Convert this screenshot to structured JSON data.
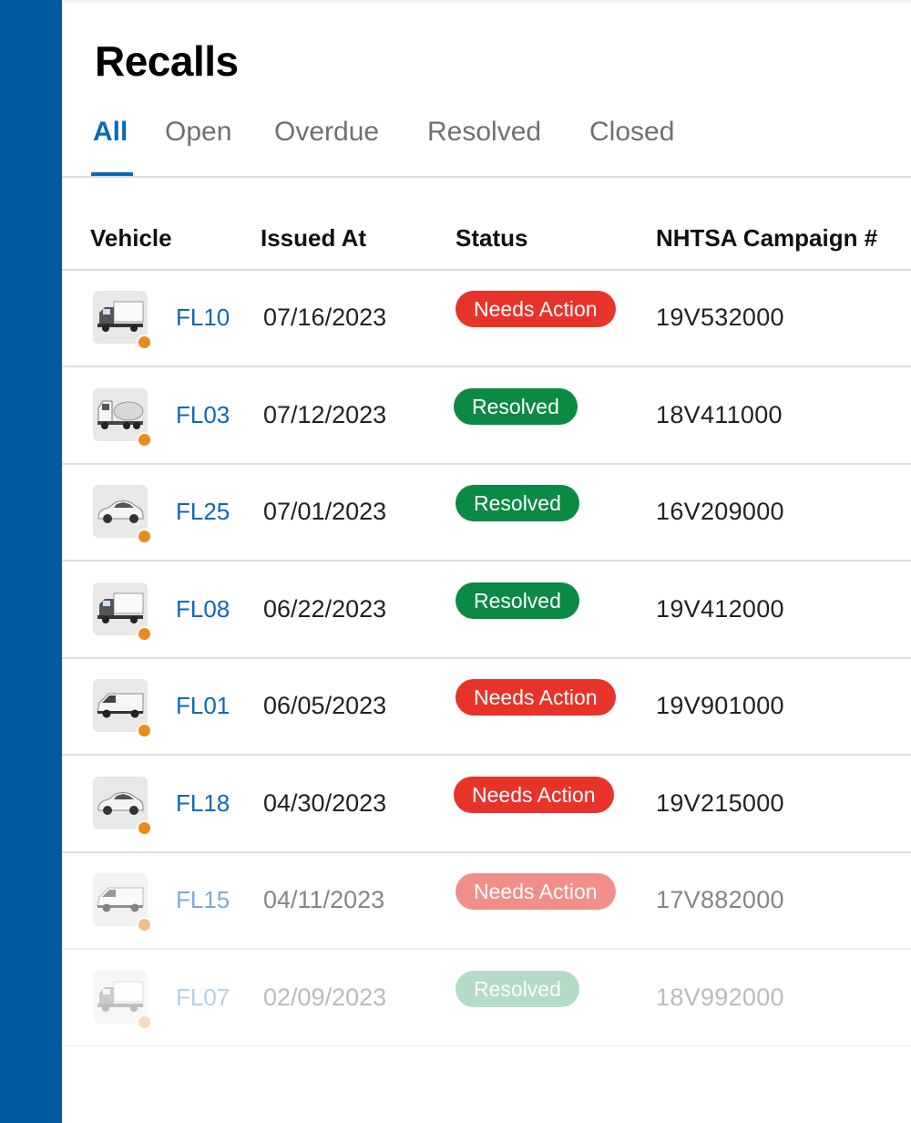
{
  "page": {
    "title": "Recalls"
  },
  "tabs": [
    {
      "label": "All",
      "active": true
    },
    {
      "label": "Open",
      "active": false
    },
    {
      "label": "Overdue",
      "active": false
    },
    {
      "label": "Resolved",
      "active": false
    },
    {
      "label": "Closed",
      "active": false
    }
  ],
  "table": {
    "columns": [
      "Vehicle",
      "Issued At",
      "Status",
      "NHTSA Campaign #"
    ],
    "rows": [
      {
        "vehicle": "FL10",
        "type": "box-truck",
        "issued": "07/16/2023",
        "status": "Needs Action",
        "campaign": "19V532000"
      },
      {
        "vehicle": "FL03",
        "type": "tanker-truck",
        "issued": "07/12/2023",
        "status": "Resolved",
        "campaign": "18V411000"
      },
      {
        "vehicle": "FL25",
        "type": "sedan",
        "issued": "07/01/2023",
        "status": "Resolved",
        "campaign": "16V209000"
      },
      {
        "vehicle": "FL08",
        "type": "box-truck",
        "issued": "06/22/2023",
        "status": "Resolved",
        "campaign": "19V412000"
      },
      {
        "vehicle": "FL01",
        "type": "van",
        "issued": "06/05/2023",
        "status": "Needs Action",
        "campaign": "19V901000"
      },
      {
        "vehicle": "FL18",
        "type": "sedan",
        "issued": "04/30/2023",
        "status": "Needs Action",
        "campaign": "19V215000"
      },
      {
        "vehicle": "FL15",
        "type": "van",
        "issued": "04/11/2023",
        "status": "Needs Action",
        "campaign": "17V882000"
      },
      {
        "vehicle": "FL07",
        "type": "box-truck",
        "issued": "02/09/2023",
        "status": "Resolved",
        "campaign": "18V992000"
      }
    ]
  },
  "colors": {
    "sidebar": "#0358a2",
    "link": "#0a6ab4",
    "needs_action": "#e8332b",
    "resolved": "#0b8a44",
    "indicator_dot": "#e98b1e"
  }
}
